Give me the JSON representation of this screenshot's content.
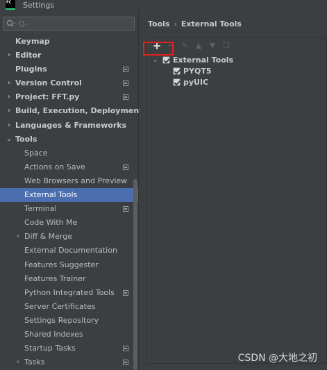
{
  "window": {
    "title": "Settings",
    "logo_text": "PC"
  },
  "search": {
    "placeholder": "Q-",
    "value": ""
  },
  "sidebar": {
    "items": [
      {
        "label": "Keymap",
        "level": 0,
        "bold": true,
        "arrow": "",
        "proj": false
      },
      {
        "label": "Editor",
        "level": 0,
        "bold": true,
        "arrow": "›",
        "proj": false
      },
      {
        "label": "Plugins",
        "level": 0,
        "bold": true,
        "arrow": "",
        "proj": true
      },
      {
        "label": "Version Control",
        "level": 0,
        "bold": true,
        "arrow": "›",
        "proj": true
      },
      {
        "label": "Project: FFT.py",
        "level": 0,
        "bold": true,
        "arrow": "›",
        "proj": true
      },
      {
        "label": "Build, Execution, Deployment",
        "level": 0,
        "bold": true,
        "arrow": "›",
        "proj": false
      },
      {
        "label": "Languages & Frameworks",
        "level": 0,
        "bold": true,
        "arrow": "›",
        "proj": false
      },
      {
        "label": "Tools",
        "level": 0,
        "bold": true,
        "arrow": "⌄",
        "proj": false
      },
      {
        "label": "Space",
        "level": 1,
        "bold": false,
        "arrow": "",
        "proj": false
      },
      {
        "label": "Actions on Save",
        "level": 1,
        "bold": false,
        "arrow": "",
        "proj": true
      },
      {
        "label": "Web Browsers and Preview",
        "level": 1,
        "bold": false,
        "arrow": "",
        "proj": false
      },
      {
        "label": "External Tools",
        "level": 1,
        "bold": false,
        "arrow": "",
        "proj": false,
        "selected": true
      },
      {
        "label": "Terminal",
        "level": 1,
        "bold": false,
        "arrow": "",
        "proj": true
      },
      {
        "label": "Code With Me",
        "level": 1,
        "bold": false,
        "arrow": "",
        "proj": false
      },
      {
        "label": "Diff & Merge",
        "level": 1,
        "bold": false,
        "arrow": "›",
        "proj": false
      },
      {
        "label": "External Documentation",
        "level": 1,
        "bold": false,
        "arrow": "",
        "proj": false
      },
      {
        "label": "Features Suggester",
        "level": 1,
        "bold": false,
        "arrow": "",
        "proj": false
      },
      {
        "label": "Features Trainer",
        "level": 1,
        "bold": false,
        "arrow": "",
        "proj": false
      },
      {
        "label": "Python Integrated Tools",
        "level": 1,
        "bold": false,
        "arrow": "",
        "proj": true
      },
      {
        "label": "Server Certificates",
        "level": 1,
        "bold": false,
        "arrow": "",
        "proj": false
      },
      {
        "label": "Settings Repository",
        "level": 1,
        "bold": false,
        "arrow": "",
        "proj": false
      },
      {
        "label": "Shared Indexes",
        "level": 1,
        "bold": false,
        "arrow": "",
        "proj": false
      },
      {
        "label": "Startup Tasks",
        "level": 1,
        "bold": false,
        "arrow": "",
        "proj": true
      },
      {
        "label": "Tasks",
        "level": 1,
        "bold": false,
        "arrow": "›",
        "proj": true
      }
    ]
  },
  "breadcrumb": {
    "parent": "Tools",
    "separator": "›",
    "current": "External Tools"
  },
  "toolbar": {
    "add": "+",
    "remove": "−",
    "edit": "✎",
    "up": "▲",
    "down": "▼",
    "copy": "❐"
  },
  "tree": {
    "group": {
      "label": "External Tools",
      "checked": true,
      "expanded": true
    },
    "children": [
      {
        "label": "PYQT5",
        "checked": true
      },
      {
        "label": "pyUIC",
        "checked": true
      }
    ]
  },
  "watermark": "CSDN @大地之初",
  "colors": {
    "background": "#3c3f41",
    "selection": "#4b6eaf",
    "highlight_box": "#e0201a",
    "text": "#bbbbbb"
  }
}
